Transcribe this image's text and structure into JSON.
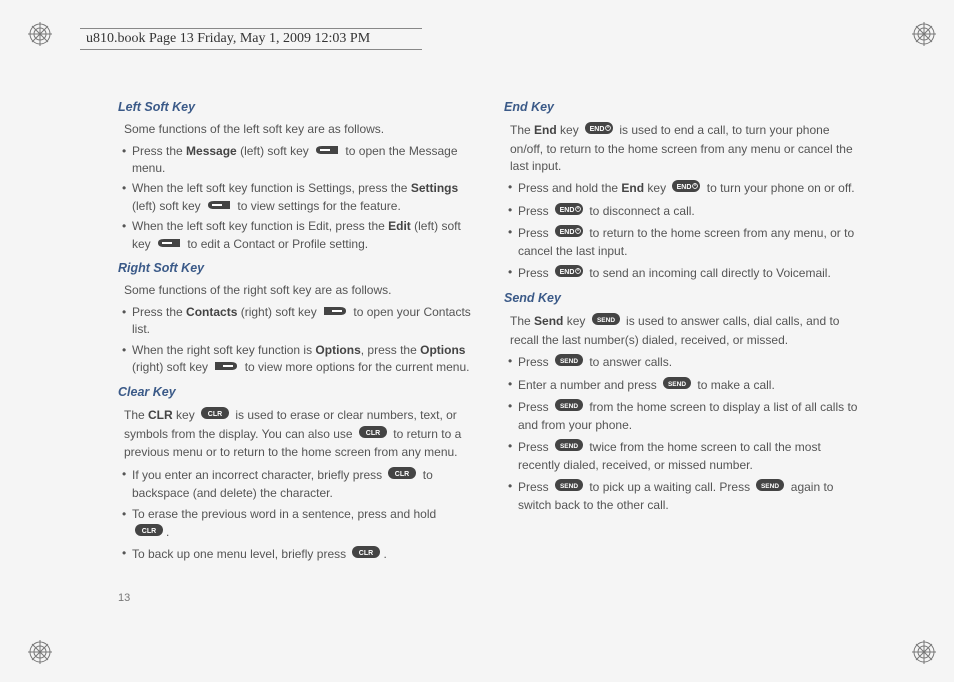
{
  "header": "u810.book  Page 13  Friday, May 1, 2009  12:03 PM",
  "page_number": "13",
  "left": {
    "s1": {
      "title": "Left Soft Key",
      "intro": "Some functions of the left soft key are as follows.",
      "b1a": "Press the ",
      "b1b": "Message",
      "b1c": " (left) soft key ",
      "b1d": " to open the Message menu.",
      "b2a": "When the left soft key function is Settings, press the ",
      "b2b": "Settings",
      "b2c": " (left) soft key ",
      "b2d": " to view settings for the feature.",
      "b3a": "When the left soft key function is Edit, press the ",
      "b3b": "Edit",
      "b3c": " (left) soft key ",
      "b3d": " to edit a Contact or Profile setting."
    },
    "s2": {
      "title": "Right Soft Key",
      "intro": "Some functions of the right soft key are as follows.",
      "b1a": "Press the ",
      "b1b": "Contacts",
      "b1c": " (right) soft key ",
      "b1d": " to open your Contacts list.",
      "b2a": "When the right soft key function is ",
      "b2b": "Options",
      "b2c": ", press the ",
      "b2d": "Options",
      "b2e": " (right) soft key ",
      "b2f": " to view more options for the current menu."
    },
    "s3": {
      "title": "Clear Key",
      "p1a": "The ",
      "p1b": "CLR",
      "p1c": " key ",
      "p1d": " is used to erase or clear numbers, text, or symbols from the display. You can also use ",
      "p1e": " to return to a previous menu or to return to the home screen from any menu.",
      "b1a": "If you enter an incorrect character, briefly press ",
      "b1b": " to backspace (and delete) the character.",
      "b2a": "To erase the previous word in a sentence, press and hold ",
      "b2b": ".",
      "b3a": "To back up one menu level, briefly press ",
      "b3b": "."
    }
  },
  "right": {
    "s1": {
      "title": "End Key",
      "p1a": "The ",
      "p1b": "End",
      "p1c": " key ",
      "p1d": " is used to end a call, to turn your phone on/off, to return to the home screen from any menu or cancel the last input.",
      "b1a": "Press and hold the ",
      "b1b": "End",
      "b1c": " key ",
      "b1d": " to turn your phone on or off.",
      "b2a": "Press ",
      "b2b": " to disconnect a call.",
      "b3a": "Press ",
      "b3b": " to return to the home screen from any menu, or to cancel the last input.",
      "b4a": "Press ",
      "b4b": " to send an incoming call directly to Voicemail."
    },
    "s2": {
      "title": "Send Key",
      "p1a": "The ",
      "p1b": "Send",
      "p1c": " key ",
      "p1d": " is used to answer calls, dial calls, and to recall the last number(s) dialed, received, or missed.",
      "b1a": "Press ",
      "b1b": " to answer calls.",
      "b2a": "Enter a number and press ",
      "b2b": " to make a call.",
      "b3a": "Press ",
      "b3b": " from the home screen to display a list of all calls to and from your phone.",
      "b4a": "Press ",
      "b4b": " twice from the home screen to call the most recently dialed, received, or missed number.",
      "b5a": "Press ",
      "b5b": " to pick up a waiting call. Press ",
      "b5c": " again to switch back to the other call."
    }
  },
  "keys": {
    "clr": "CLR",
    "end": "END",
    "send": "SEND"
  }
}
